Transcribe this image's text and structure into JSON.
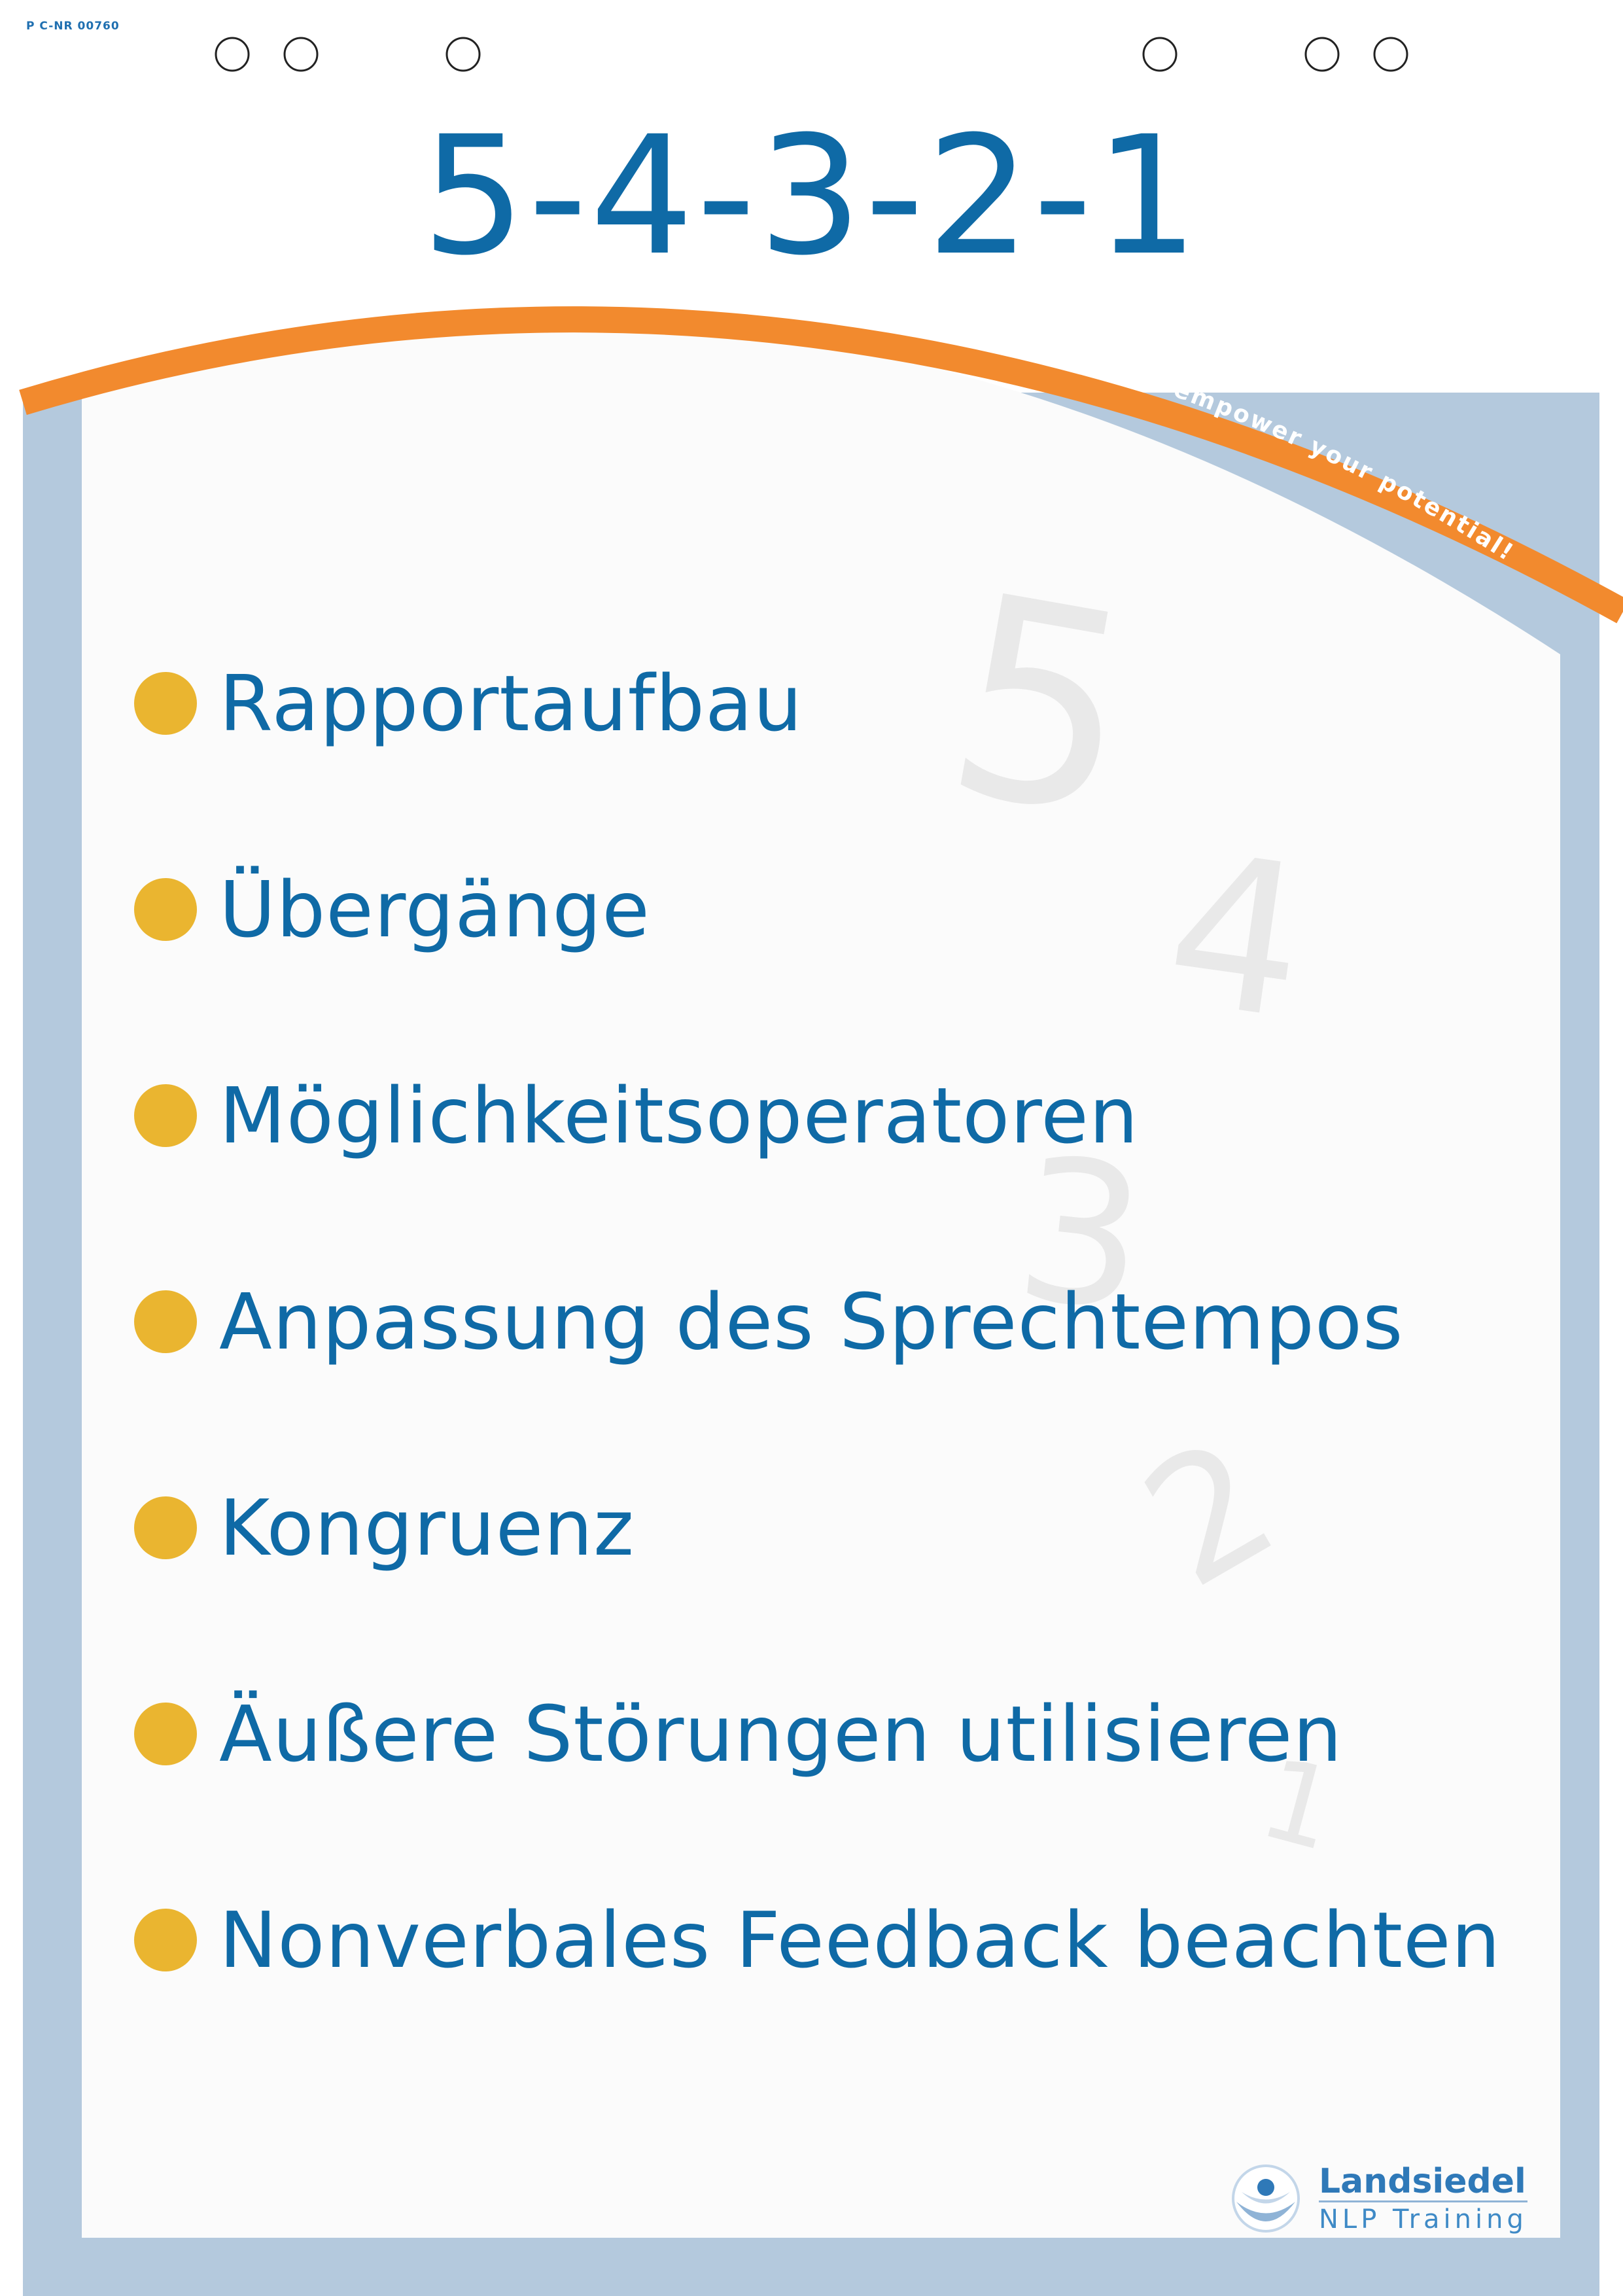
{
  "document": {
    "code": "P C-NR 00760",
    "title": "5-4-3-2-1",
    "slogan": "... empower your potential!",
    "items": [
      "Rapportaufbau",
      "Übergänge",
      "Möglichkeitsoperatoren",
      "Anpassung des Sprechtempos",
      "Kongruenz",
      "Äußere Störungen utilisieren",
      "Nonverbales Feedback beachten"
    ],
    "background_numbers": [
      "5",
      "4",
      "3",
      "2",
      "1"
    ]
  },
  "logo": {
    "name": "Landsiedel",
    "subtitle": "NLP Training"
  },
  "colors": {
    "title_blue": "#0f6aa6",
    "bullet_yellow": "#eab530",
    "arc_orange": "#f28a2e",
    "frame_blue": "#b4c9dd",
    "ghost_number_gray": "#e9e9e9"
  }
}
